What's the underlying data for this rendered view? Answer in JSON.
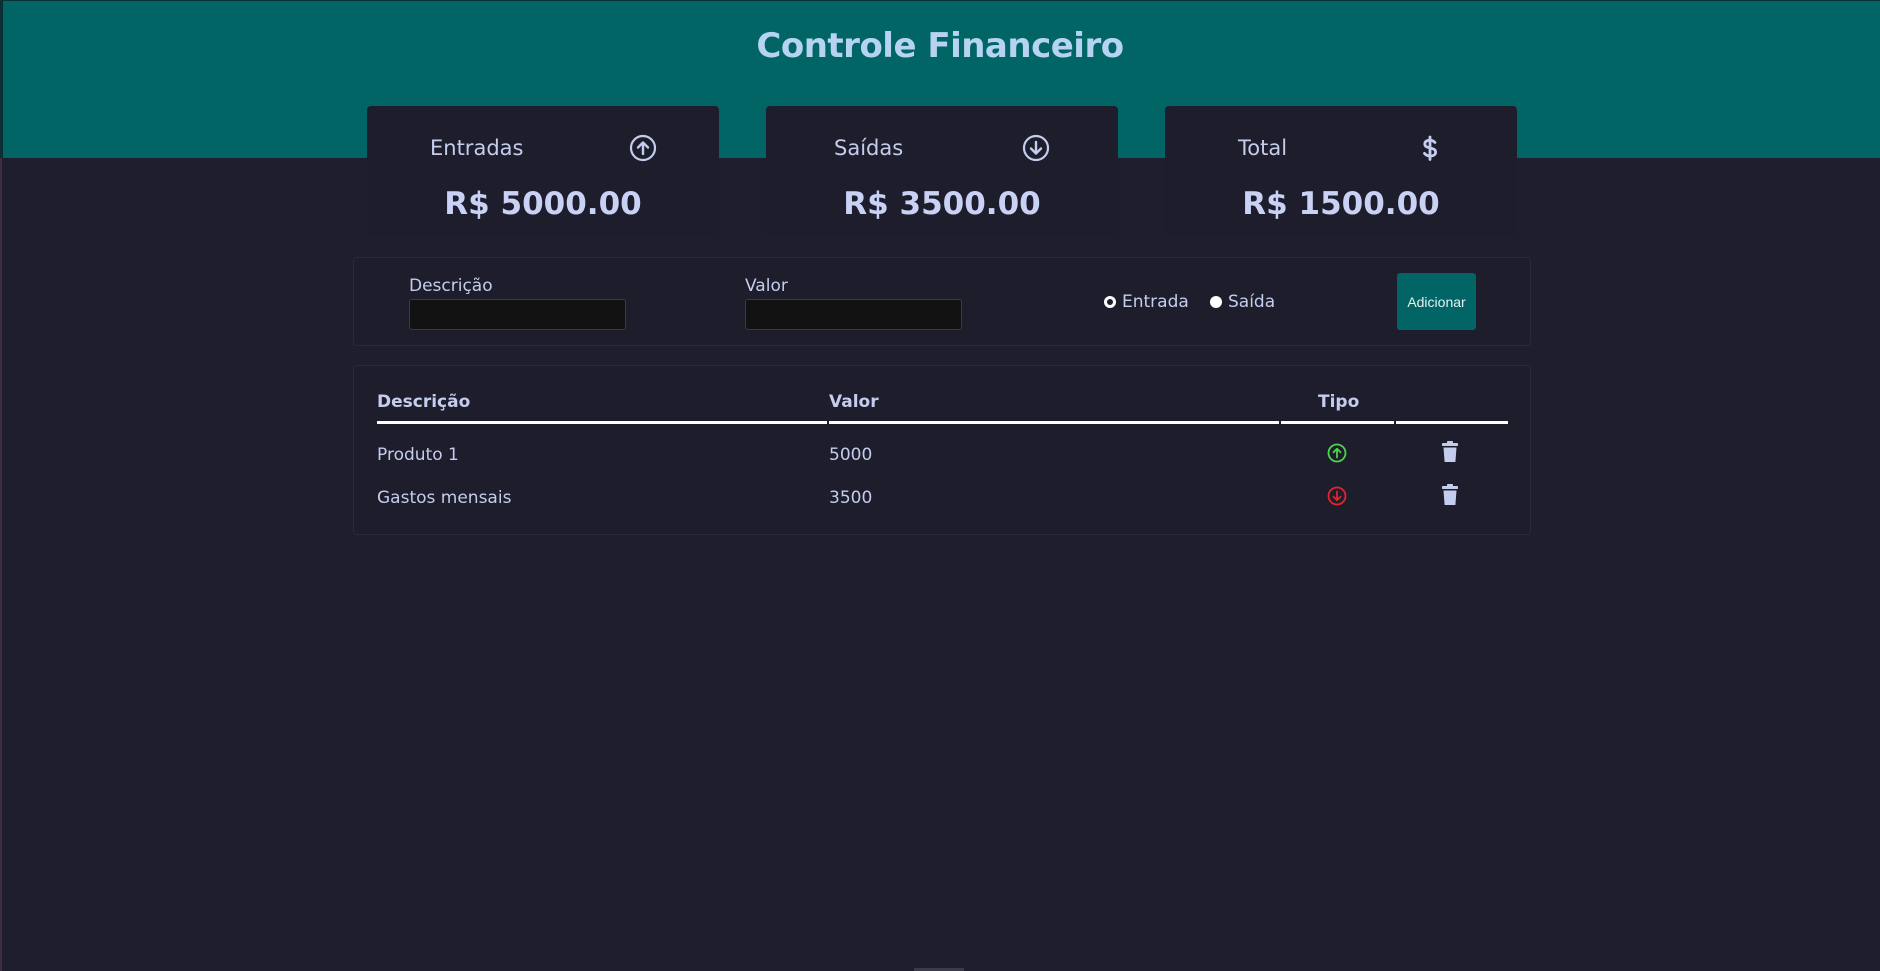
{
  "app": {
    "title": "Controle Financeiro"
  },
  "summary": {
    "income": {
      "label": "Entradas",
      "amount": "R$ 5000.00",
      "icon": "arrow-circle-up-icon"
    },
    "expense": {
      "label": "Saídas",
      "amount": "R$ 3500.00",
      "icon": "arrow-circle-down-icon"
    },
    "total": {
      "label": "Total",
      "amount": "R$ 1500.00",
      "icon": "dollar-icon"
    }
  },
  "form": {
    "description_label": "Descrição",
    "description_value": "",
    "value_label": "Valor",
    "value_value": "",
    "radio_income_label": "Entrada",
    "radio_expense_label": "Saída",
    "selected_type": "Entrada",
    "add_button_label": "Adicionar"
  },
  "table": {
    "headers": {
      "description": "Descrição",
      "value": "Valor",
      "type": "Tipo"
    },
    "rows": [
      {
        "description": "Produto 1",
        "value": "5000",
        "type": "entrada",
        "type_icon": "arrow-circle-up-icon"
      },
      {
        "description": "Gastos mensais",
        "value": "3500",
        "type": "saida",
        "type_icon": "arrow-circle-down-icon"
      }
    ]
  },
  "colors": {
    "header_bg": "#016566",
    "page_bg": "#1f1e2d",
    "card_bg": "#1e1d2c",
    "accent_text": "#b6d4f2",
    "income_icon": "#4cd44c",
    "expense_icon": "#e0252c"
  }
}
